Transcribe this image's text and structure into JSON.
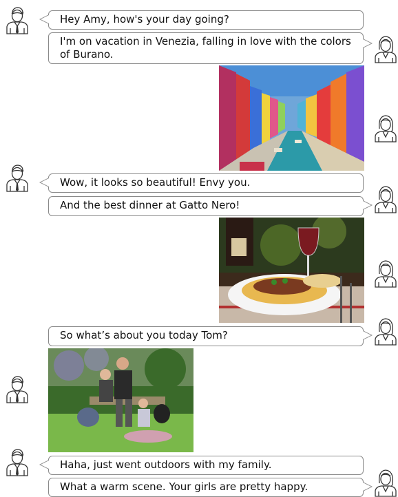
{
  "participants": {
    "left": {
      "name": "Tom",
      "icon": "man-avatar-icon"
    },
    "right": {
      "name": "Amy",
      "icon": "woman-avatar-icon"
    }
  },
  "messages": [
    {
      "from": "Tom",
      "type": "text",
      "text": "Hey Amy, how's your day going?"
    },
    {
      "from": "Amy",
      "type": "text",
      "text": "I'm on vacation in Venezia, falling in love with the colors of Burano."
    },
    {
      "from": "Amy",
      "type": "image",
      "subject": "burano-canal-photo"
    },
    {
      "from": "Tom",
      "type": "text",
      "text": "Wow, it looks so beautiful! Envy you."
    },
    {
      "from": "Amy",
      "type": "text",
      "text": "And the best dinner at Gatto Nero!"
    },
    {
      "from": "Amy",
      "type": "image",
      "subject": "pasta-dinner-photo"
    },
    {
      "from": "Amy",
      "type": "text",
      "text": "So what’s about you today Tom?"
    },
    {
      "from": "Tom",
      "type": "image",
      "subject": "family-outdoors-photo"
    },
    {
      "from": "Tom",
      "type": "text",
      "text": "Haha, just went outdoors with my family."
    },
    {
      "from": "Amy",
      "type": "text",
      "text": "What a warm scene. Your girls are pretty happy."
    }
  ],
  "colors": {
    "bubble_border": "#8a8a8a",
    "background": "#ffffff",
    "text": "#111111"
  }
}
